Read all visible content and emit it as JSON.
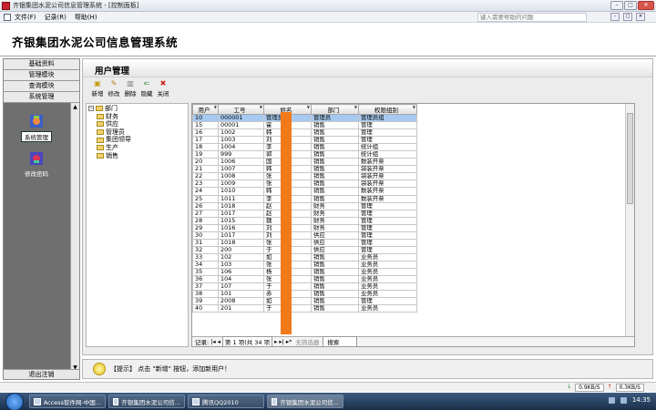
{
  "window": {
    "title": "齐银集团水泥公司信息管理系统 - [控制面板]"
  },
  "menubar": {
    "items": [
      "文件(F)",
      "记录(R)",
      "帮助(H)"
    ],
    "help_placeholder": "键入需要帮助的问题"
  },
  "header": {
    "title": "齐银集团水泥公司信息管理系统"
  },
  "leftnav": {
    "buttons": [
      "基础资料",
      "管理模块",
      "查询模块",
      "系统管理"
    ],
    "items": [
      {
        "label": "系统管理",
        "icon": "system-manage-icon",
        "selected": true
      },
      {
        "label": "修改密码",
        "icon": "change-password-icon",
        "selected": false
      }
    ],
    "exit_label": "退出注销"
  },
  "page": {
    "title": "用户管理",
    "toolbar": [
      {
        "label": "新增",
        "icon": "new-icon"
      },
      {
        "label": "修改",
        "icon": "edit-icon"
      },
      {
        "label": "删除",
        "icon": "delete-icon"
      },
      {
        "label": "隐藏",
        "icon": "hide-icon"
      },
      {
        "label": "关闭",
        "icon": "close-icon"
      }
    ]
  },
  "tree": {
    "root": "部门",
    "children": [
      "财务",
      "供应",
      "管理员",
      "集团领导",
      "生产",
      "销售"
    ]
  },
  "grid": {
    "columns": [
      "用户",
      "工号",
      "姓名",
      "部门",
      "权限组别"
    ],
    "rows": [
      [
        "10",
        "000001",
        "管理员",
        "管理员",
        "管理员组"
      ],
      [
        "15",
        "00001",
        "霍",
        "销售",
        "管理"
      ],
      [
        "16",
        "1002",
        "韩",
        "销售",
        "管理"
      ],
      [
        "17",
        "1003",
        "刘",
        "销售",
        "管理"
      ],
      [
        "18",
        "1004",
        "李",
        "销售",
        "统计组"
      ],
      [
        "19",
        "999",
        "郭",
        "销售",
        "统计组"
      ],
      [
        "20",
        "1006",
        "国",
        "销售",
        "数装开票"
      ],
      [
        "21",
        "1007",
        "韩",
        "销售",
        "袋装开票"
      ],
      [
        "22",
        "1008",
        "张",
        "销售",
        "袋装开票"
      ],
      [
        "23",
        "1009",
        "张",
        "销售",
        "袋装开票"
      ],
      [
        "24",
        "1010",
        "韩",
        "销售",
        "数装开票"
      ],
      [
        "25",
        "1011",
        "李",
        "销售",
        "数装开票"
      ],
      [
        "26",
        "1018",
        "赵",
        "财务",
        "管理"
      ],
      [
        "27",
        "1017",
        "赵",
        "财务",
        "管理"
      ],
      [
        "28",
        "1015",
        "魏",
        "财务",
        "管理"
      ],
      [
        "29",
        "1016",
        "刘",
        "财务",
        "管理"
      ],
      [
        "30",
        "1017",
        "刘",
        "供应",
        "管理"
      ],
      [
        "31",
        "1018",
        "张",
        "供应",
        "管理"
      ],
      [
        "32",
        "200",
        "于",
        "供应",
        "管理"
      ],
      [
        "33",
        "102",
        "如",
        "销售",
        "业务员"
      ],
      [
        "34",
        "103",
        "张",
        "销售",
        "业务员"
      ],
      [
        "35",
        "106",
        "杨",
        "销售",
        "业务员"
      ],
      [
        "36",
        "104",
        "张",
        "销售",
        "业务员"
      ],
      [
        "37",
        "107",
        "于",
        "销售",
        "业务员"
      ],
      [
        "38",
        "101",
        "赤",
        "销售",
        "业务员"
      ],
      [
        "39",
        "2008",
        "如",
        "销售",
        "管理"
      ],
      [
        "40",
        "201",
        "于",
        "销售",
        "业务员"
      ]
    ],
    "record_nav": {
      "label": "记录:",
      "position": "第 1 项(共 34 项",
      "filter": "无筛选器",
      "search": "搜索"
    }
  },
  "hint": {
    "text": "【提示】 点击 \"新增\" 按钮，添加新用户！"
  },
  "status": {
    "down": "0.9KB/S",
    "up": "0.3KB/S"
  },
  "taskbar": {
    "tasks": [
      "Access软件网-中国...",
      "齐银集团水泥公司信...",
      "腾讯QQ2010",
      "齐银集团水泥公司信..."
    ],
    "clock": "14:35"
  },
  "colors": {
    "selection": "#a6caf0",
    "redaction": "#f07a1a",
    "taskbar": "#1c2f4a"
  }
}
